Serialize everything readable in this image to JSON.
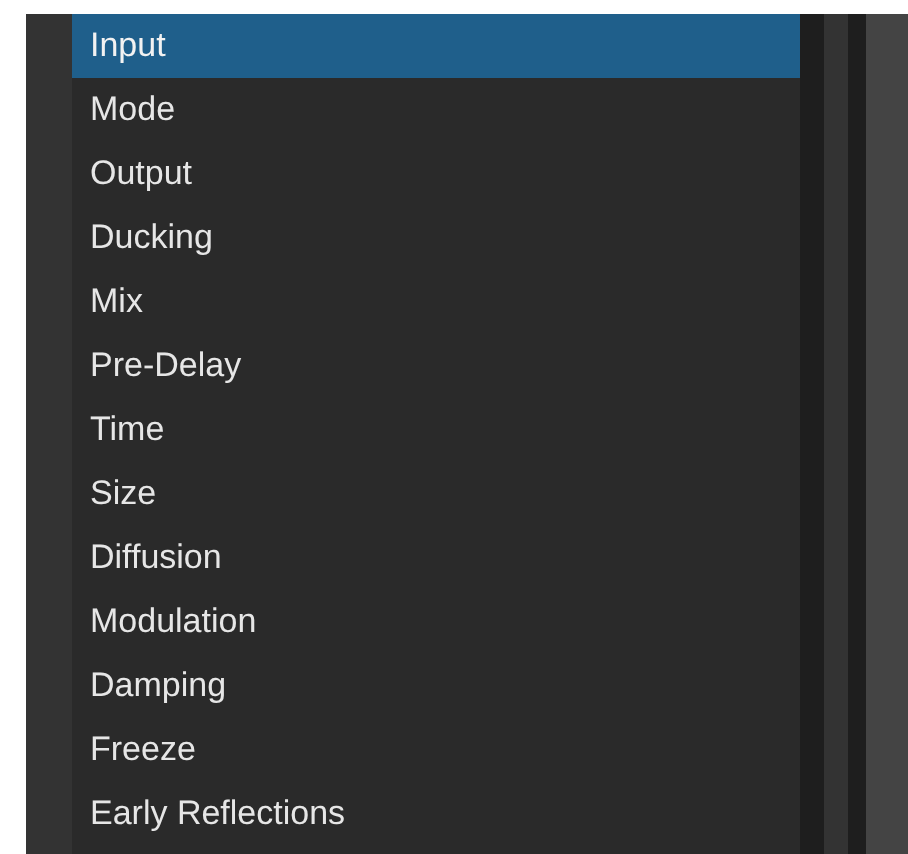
{
  "parameter_list": {
    "items": [
      {
        "label": "Input",
        "selected": true
      },
      {
        "label": "Mode",
        "selected": false
      },
      {
        "label": "Output",
        "selected": false
      },
      {
        "label": "Ducking",
        "selected": false
      },
      {
        "label": "Mix",
        "selected": false
      },
      {
        "label": "Pre-Delay",
        "selected": false
      },
      {
        "label": "Time",
        "selected": false
      },
      {
        "label": "Size",
        "selected": false
      },
      {
        "label": "Diffusion",
        "selected": false
      },
      {
        "label": "Modulation",
        "selected": false
      },
      {
        "label": "Damping",
        "selected": false
      },
      {
        "label": "Freeze",
        "selected": false
      },
      {
        "label": "Early Reflections",
        "selected": false
      }
    ]
  }
}
